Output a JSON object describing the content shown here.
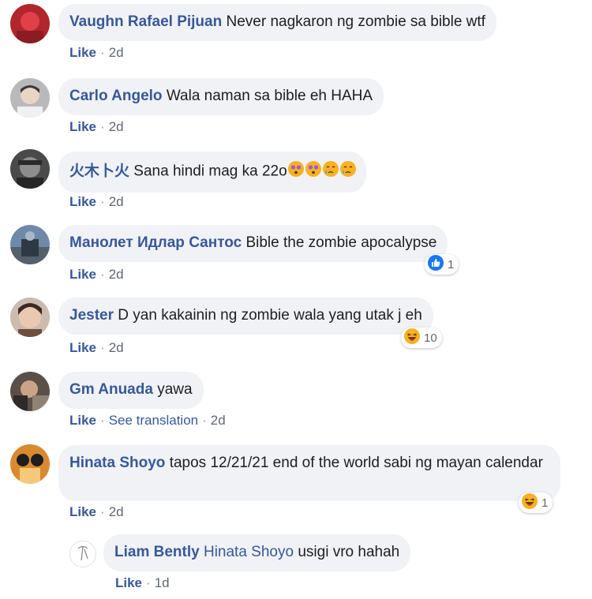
{
  "comments": [
    {
      "author": "Vaughn Rafael Pijuan",
      "text": "Never nagkaron ng zombie sa bible wtf",
      "like": "Like",
      "time": "2d"
    },
    {
      "author": "Carlo Angelo",
      "text": "Wala naman sa bible eh HAHA",
      "like": "Like",
      "time": "2d"
    },
    {
      "author": "火木卜火",
      "text": "Sana hindi mag ka 22o",
      "emojis": [
        "dizzy-face-emoji",
        "dizzy-face-emoji",
        "crying-face-emoji",
        "crying-face-emoji"
      ],
      "like": "Like",
      "time": "2d"
    },
    {
      "author": "Манолет Идлар Сантос",
      "text": "Bible the zombie apocalypse",
      "like": "Like",
      "time": "2d",
      "reaction": {
        "icon": "like-reaction-icon",
        "count": "1",
        "color": "#1877f2"
      }
    },
    {
      "author": "Jester",
      "text": "D yan kakainin ng zombie wala yang utak j eh",
      "like": "Like",
      "time": "2d",
      "reaction": {
        "icon": "haha-reaction-icon",
        "count": "10",
        "color": "#f7b125"
      }
    },
    {
      "author": "Gm Anuada",
      "text": "yawa",
      "like": "Like",
      "see_translation": "See translation",
      "time": "2d"
    },
    {
      "author": "Hinata Shoyo",
      "text": "tapos 12/21/21 end of the world sabi ng mayan calendar",
      "like": "Like",
      "time": "2d",
      "reaction": {
        "icon": "haha-reaction-icon",
        "count": "1",
        "color": "#f7b125"
      }
    }
  ],
  "reply": {
    "author": "Liam Bently",
    "mention": "Hinata Shoyo",
    "text": "usigi vro hahah",
    "like": "Like",
    "time": "1d"
  },
  "colors": {
    "author": "#385898",
    "bubble": "#f0f2f5",
    "like_blue": "#1877f2",
    "haha_yellow": "#f7b125"
  }
}
